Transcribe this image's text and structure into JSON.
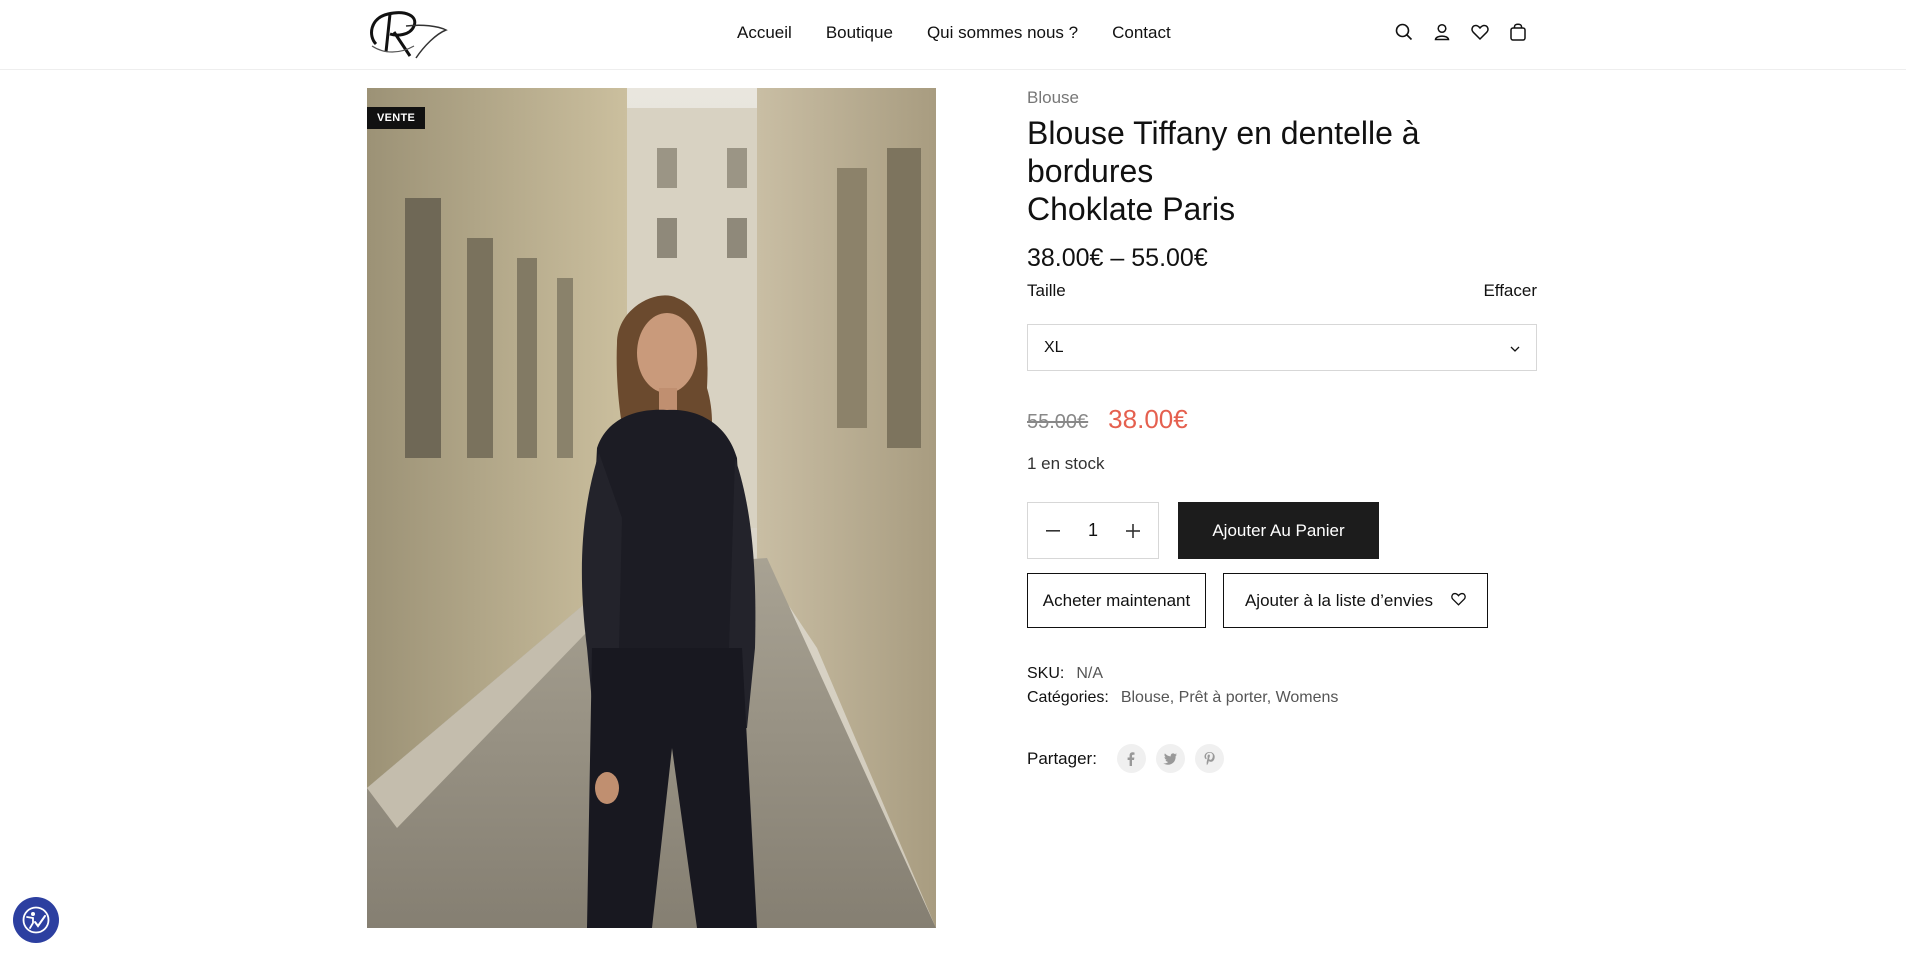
{
  "header": {
    "nav": [
      "Accueil",
      "Boutique",
      "Qui sommes nous ?",
      "Contact"
    ],
    "icons": [
      "search-icon",
      "user-icon",
      "heart-icon",
      "bag-icon"
    ]
  },
  "product": {
    "badge": "VENTE",
    "category": "Blouse",
    "title_line1": "Blouse Tiffany en dentelle à bordures",
    "title_line2": "Choklate Paris",
    "price_range": "38.00€ – 55.00€",
    "size_label": "Taille",
    "clear_label": "Effacer",
    "size_selected": "XL",
    "old_price": "55.00€",
    "new_price": "38.00€",
    "stock": "1 en stock",
    "quantity": "1",
    "add_to_cart": "Ajouter Au Panier",
    "buy_now": "Acheter maintenant",
    "add_to_wishlist": "Ajouter à la liste d’envies",
    "sku_label": "SKU:",
    "sku_value": "N/A",
    "categories_label": "Catégories:",
    "categories_value": "Blouse, Prêt à porter, Womens",
    "share_label": "Partager:",
    "share_icons": [
      "facebook-icon",
      "twitter-icon",
      "pinterest-icon"
    ]
  },
  "colors": {
    "sale_price": "#e5604f",
    "button_dark": "#1c1c1c",
    "accessibility": "#2c3fa0"
  }
}
